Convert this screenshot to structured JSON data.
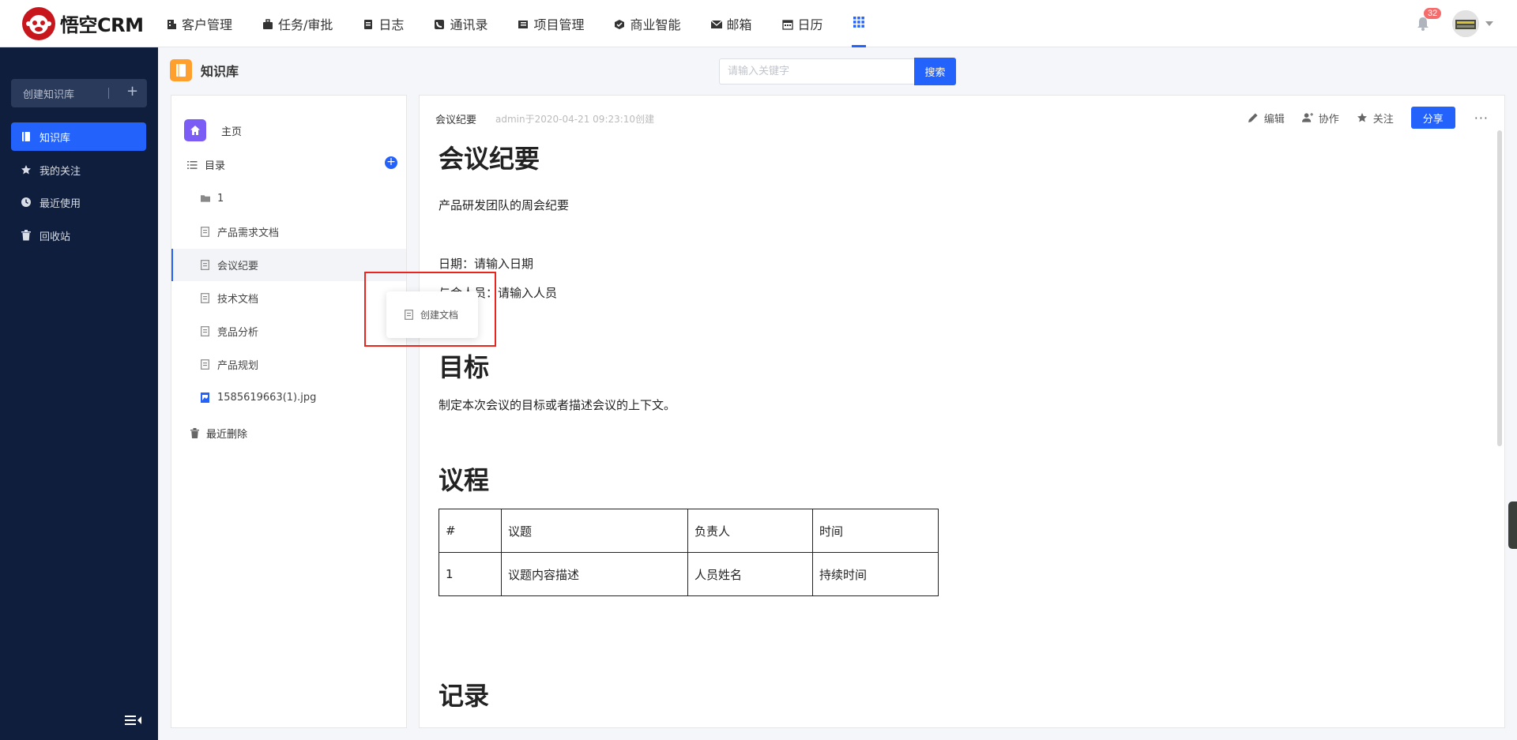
{
  "app": {
    "logo_text": "悟空CRM"
  },
  "nav": {
    "items": [
      {
        "label": "客户管理",
        "icon": "customer-icon"
      },
      {
        "label": "任务/审批",
        "icon": "briefcase-icon"
      },
      {
        "label": "日志",
        "icon": "log-icon"
      },
      {
        "label": "通讯录",
        "icon": "contacts-icon"
      },
      {
        "label": "项目管理",
        "icon": "project-icon"
      },
      {
        "label": "商业智能",
        "icon": "bi-icon"
      },
      {
        "label": "邮箱",
        "icon": "mail-icon"
      },
      {
        "label": "日历",
        "icon": "calendar-icon"
      }
    ],
    "notification_count": "32"
  },
  "sidebar": {
    "create_label": "创建知识库",
    "items": [
      {
        "label": "知识库",
        "icon": "book-icon",
        "active": true
      },
      {
        "label": "我的关注",
        "icon": "star-icon"
      },
      {
        "label": "最近使用",
        "icon": "clock-icon"
      },
      {
        "label": "回收站",
        "icon": "trash-icon"
      }
    ]
  },
  "page": {
    "title": "知识库",
    "search_placeholder": "请输入关键字",
    "search_button": "搜索"
  },
  "tree": {
    "home_label": "主页",
    "directory_label": "目录",
    "nodes": [
      {
        "label": "1",
        "type": "folder"
      },
      {
        "label": "产品需求文档",
        "type": "doc"
      },
      {
        "label": "会议纪要",
        "type": "doc",
        "selected": true
      },
      {
        "label": "技术文档",
        "type": "doc"
      },
      {
        "label": "竞品分析",
        "type": "doc"
      },
      {
        "label": "产品规划",
        "type": "doc"
      },
      {
        "label": "1585619663(1).jpg",
        "type": "image"
      }
    ],
    "trash_label": "最近删除"
  },
  "popup": {
    "label": "创建文档"
  },
  "doc": {
    "header_title": "会议纪要",
    "header_meta": "admin于2020-04-21 09:23:10创建",
    "actions": {
      "edit": "编辑",
      "collaborate": "协作",
      "follow": "关注",
      "share": "分享",
      "more": "···"
    },
    "heading_main": "会议纪要",
    "intro": "产品研发团队的周会纪要",
    "date_line": "日期：请输入日期",
    "attendees_line": "与会人员：请输入人员",
    "heading_goal": "目标",
    "goal_text": "制定本次会议的目标或者描述会议的上下文。",
    "heading_agenda": "议程",
    "agenda_table": {
      "headers": [
        "#",
        "议题",
        "负责人",
        "时间"
      ],
      "rows": [
        [
          "1",
          "议题内容描述",
          "人员姓名",
          "持续时间"
        ]
      ]
    },
    "heading_record": "记录"
  },
  "colors": {
    "primary": "#2362fb",
    "sidebar_bg": "#0f1e3d",
    "highlight": "#e8261f"
  }
}
